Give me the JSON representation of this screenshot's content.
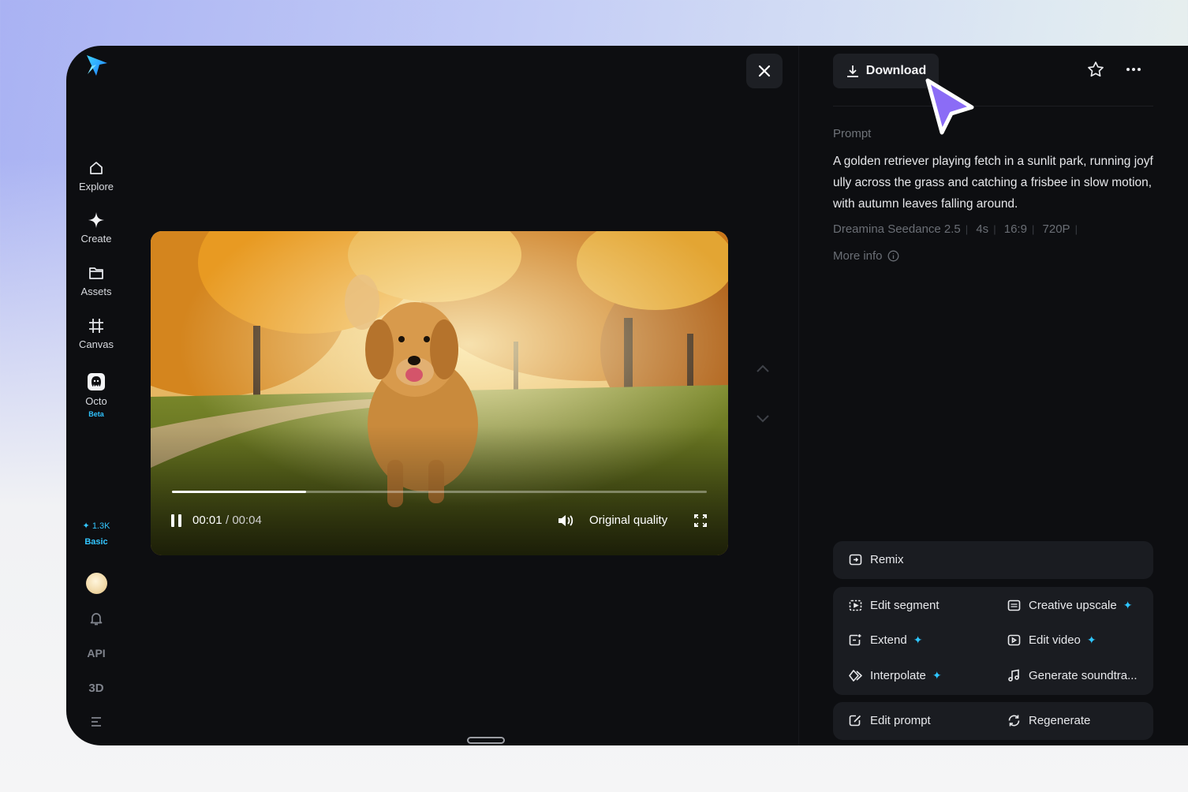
{
  "sidebar": {
    "items": [
      {
        "label": "Explore",
        "icon": "home-icon"
      },
      {
        "label": "Create",
        "icon": "sparkle-icon"
      },
      {
        "label": "Assets",
        "icon": "folder-icon"
      },
      {
        "label": "Canvas",
        "icon": "canvas-icon"
      },
      {
        "label": "Octo",
        "icon": "octo-icon",
        "badge": "Beta"
      }
    ],
    "credits": "1.3K",
    "plan": "Basic",
    "api_label": "API",
    "three_d_label": "3D"
  },
  "player": {
    "current_time": "00:01",
    "total_time": "/ 00:04",
    "progress": 0.25,
    "quality": "Original quality"
  },
  "panel": {
    "download_label": "Download",
    "prompt_label": "Prompt",
    "prompt_text": "A golden retriever playing fetch in a sunlit park, running joyfully across the grass and catching a frisbee in slow motion, with autumn leaves falling around.",
    "meta": [
      "Dreamina Seedance 2.5",
      "4s",
      "16:9",
      "720P"
    ],
    "more_info": "More info",
    "actions": {
      "remix": "Remix",
      "edit_segment": "Edit segment",
      "creative_upscale": "Creative upscale",
      "extend": "Extend",
      "edit_video": "Edit video",
      "interpolate": "Interpolate",
      "generate_soundtrack": "Generate soundtra...",
      "edit_prompt": "Edit prompt",
      "regenerate": "Regenerate"
    }
  },
  "colors": {
    "accent": "#2fc3ff",
    "background": "#0d0e11",
    "cursor": "#8b6cf6"
  }
}
